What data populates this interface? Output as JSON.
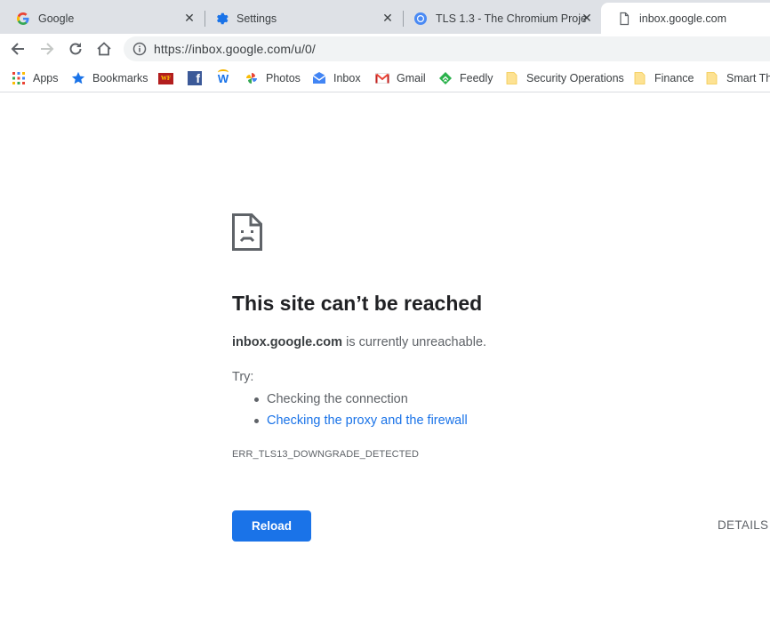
{
  "tabs": [
    {
      "title": "Google",
      "icon": "google-icon",
      "active": false
    },
    {
      "title": "Settings",
      "icon": "settings-gear-icon",
      "active": false
    },
    {
      "title": "TLS 1.3 - The Chromium Proje",
      "icon": "chromium-icon",
      "active": false
    },
    {
      "title": "inbox.google.com",
      "icon": "page-icon",
      "active": true
    }
  ],
  "toolbar": {
    "url": "https://inbox.google.com/u/0/"
  },
  "bookmarks": [
    {
      "label": "Apps",
      "icon": "apps-grid-icon"
    },
    {
      "label": "Bookmarks",
      "icon": "star-icon"
    },
    {
      "label": "",
      "icon": "wells-fargo-icon",
      "icon_text": "WF"
    },
    {
      "label": "",
      "icon": "facebook-icon",
      "icon_text": "f"
    },
    {
      "label": "",
      "icon": "w-icon",
      "icon_text": "W"
    },
    {
      "label": "Photos",
      "icon": "photos-icon"
    },
    {
      "label": "Inbox",
      "icon": "inbox-icon"
    },
    {
      "label": "Gmail",
      "icon": "gmail-icon"
    },
    {
      "label": "Feedly",
      "icon": "feedly-icon"
    },
    {
      "label": "Security Operations",
      "icon": "folder-icon"
    },
    {
      "label": "Finance",
      "icon": "folder-icon"
    },
    {
      "label": "Smart Thi",
      "icon": "folder-icon"
    }
  ],
  "error": {
    "title": "This site can’t be reached",
    "host": "inbox.google.com",
    "message_suffix": " is currently unreachable.",
    "try_label": "Try:",
    "suggestions": [
      "Checking the connection",
      "Checking the proxy and the firewall"
    ],
    "code": "ERR_TLS13_DOWNGRADE_DETECTED",
    "reload_label": "Reload",
    "details_label": "DETAILS"
  },
  "colors": {
    "accent": "#1a73e8",
    "tabstrip": "#dee1e6",
    "text_secondary": "#5f6368"
  }
}
